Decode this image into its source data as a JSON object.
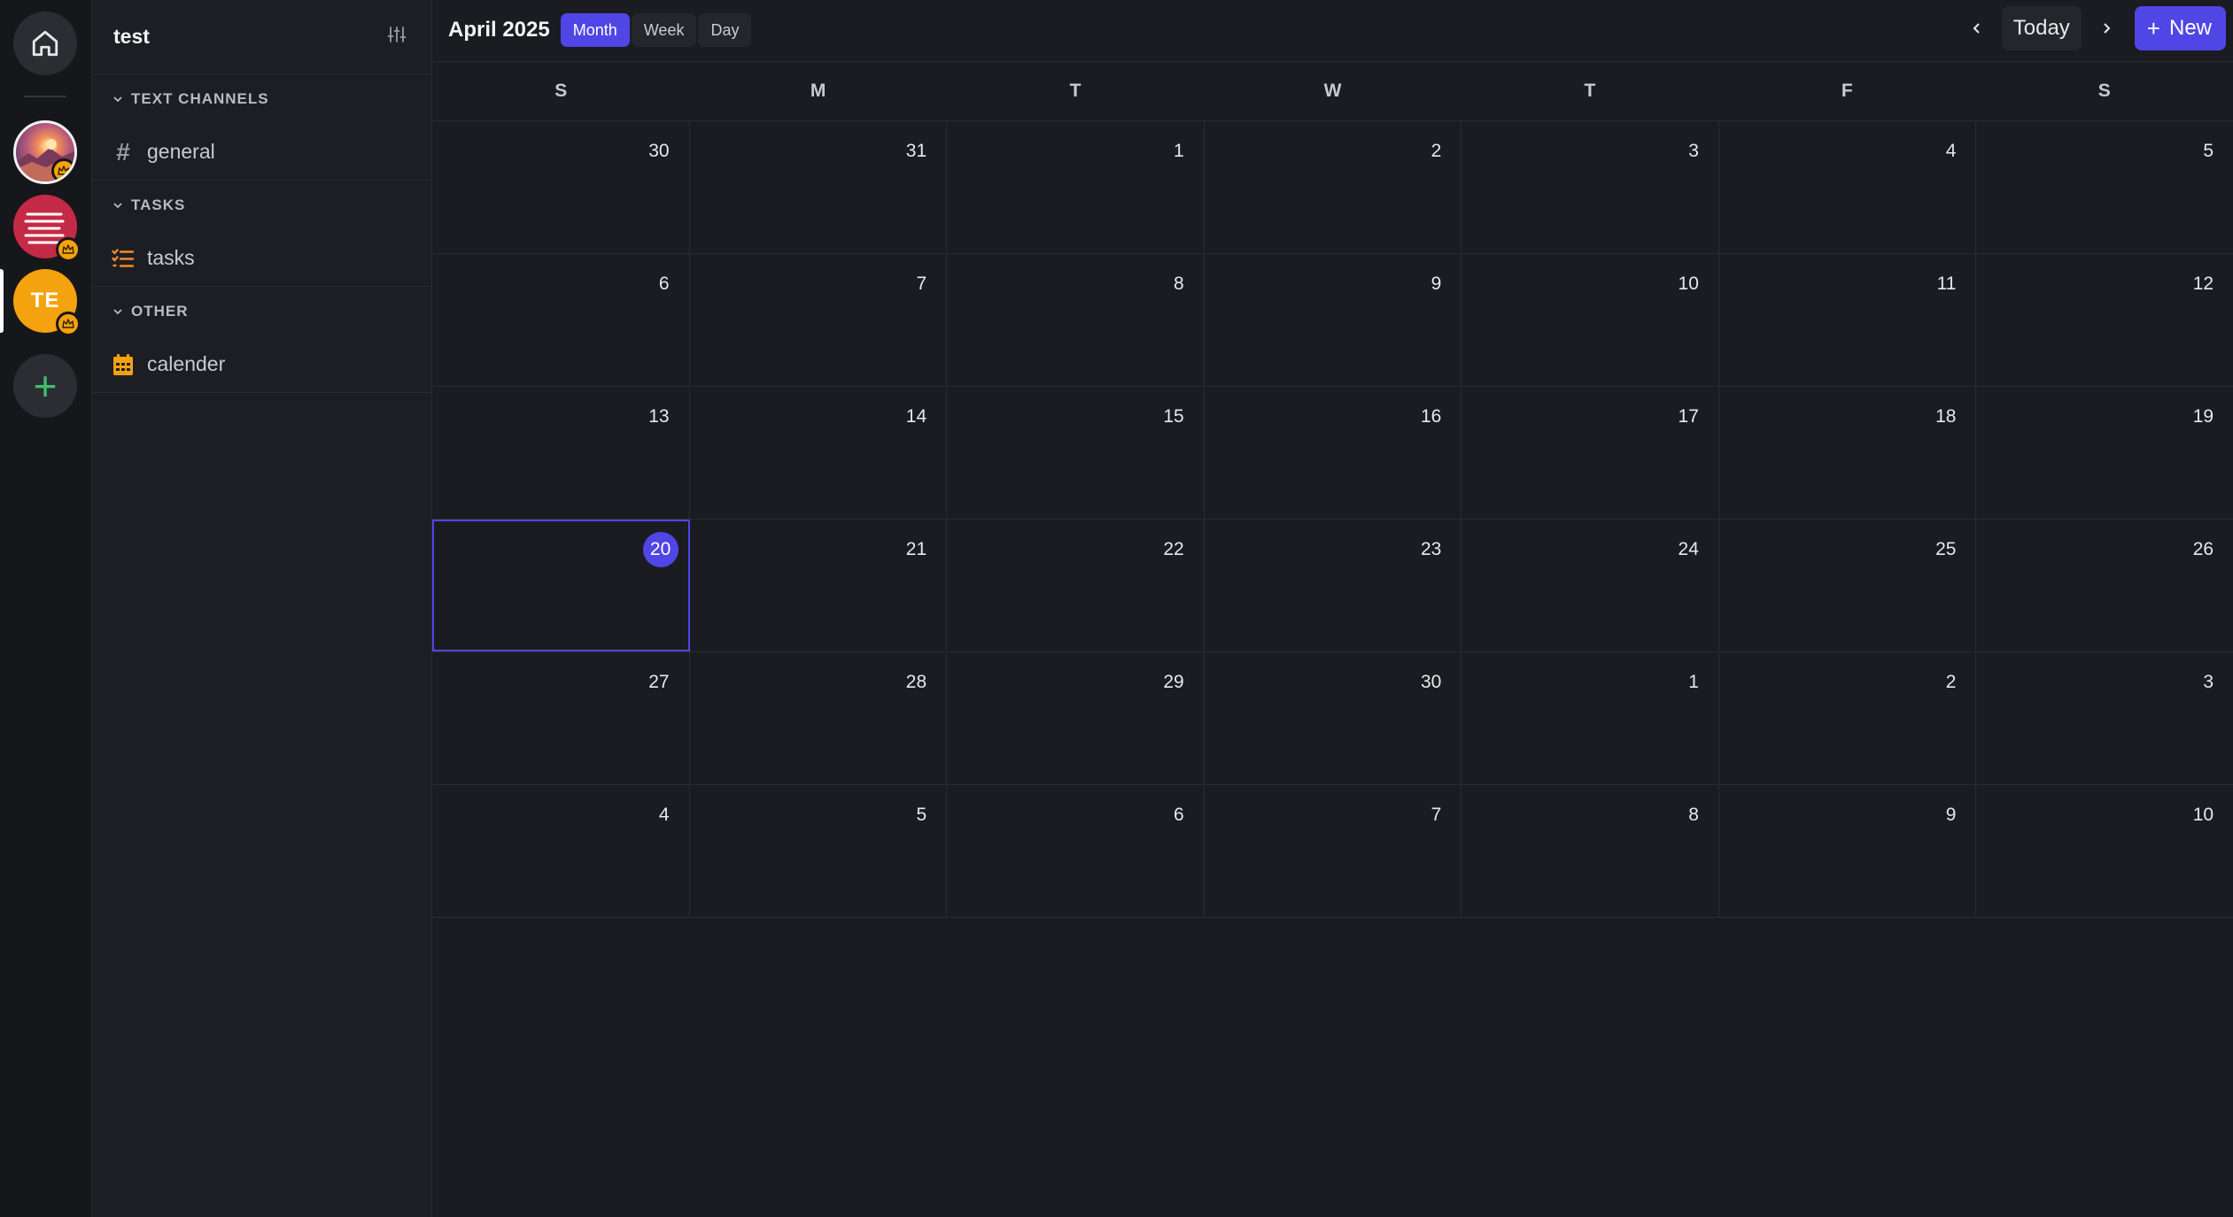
{
  "rail": {
    "servers": [
      {
        "name": "sunset-server",
        "icon": "landscape-image"
      },
      {
        "name": "books-server",
        "icon": "book-stack-icon"
      },
      {
        "name": "test-server",
        "initials": "TE"
      }
    ],
    "add_label": "+"
  },
  "sidebar": {
    "title": "test",
    "categories": [
      {
        "label": "TEXT CHANNELS",
        "channels": [
          {
            "icon": "hash-icon",
            "glyph": "#",
            "label": "general"
          }
        ]
      },
      {
        "label": "TASKS",
        "channels": [
          {
            "icon": "checklist-icon",
            "label": "tasks"
          }
        ]
      },
      {
        "label": "OTHER",
        "channels": [
          {
            "icon": "calendar-icon",
            "label": "calender"
          }
        ]
      }
    ]
  },
  "toolbar": {
    "title": "April 2025",
    "views": [
      "Month",
      "Week",
      "Day"
    ],
    "active_view": "Month",
    "today_label": "Today",
    "new_label": "New"
  },
  "calendar": {
    "weekdays": [
      "S",
      "M",
      "T",
      "W",
      "T",
      "F",
      "S"
    ],
    "today": "20",
    "weeks": [
      [
        "30",
        "31",
        "1",
        "2",
        "3",
        "4",
        "5"
      ],
      [
        "6",
        "7",
        "8",
        "9",
        "10",
        "11",
        "12"
      ],
      [
        "13",
        "14",
        "15",
        "16",
        "17",
        "18",
        "19"
      ],
      [
        "20",
        "21",
        "22",
        "23",
        "24",
        "25",
        "26"
      ],
      [
        "27",
        "28",
        "29",
        "30",
        "1",
        "2",
        "3"
      ],
      [
        "4",
        "5",
        "6",
        "7",
        "8",
        "9",
        "10"
      ]
    ]
  },
  "colors": {
    "accent": "#5046e5",
    "crown": "#f5a20f",
    "add": "#3fbf6c"
  }
}
